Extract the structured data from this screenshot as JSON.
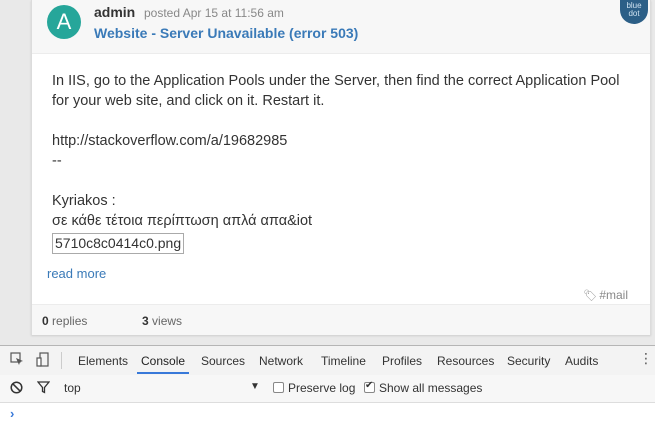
{
  "post": {
    "avatar_letter": "A",
    "author": "admin",
    "posted": "posted Apr 15 at 11:56 am",
    "subject": "Website - Server Unavailable (error 503)",
    "logo_text_1": "blue",
    "logo_text_2": "dot",
    "body_line_1": "In IIS, go to the Application Pools under the Server, then find the correct Application Pool",
    "body_line_2": "for your web site, and click on it. Restart it.",
    "link": "http://stackoverflow.com/a/19682985",
    "signature_sep": "--",
    "sender": "Kyriakos :",
    "greek_line": "σε κάθε τέτοια περίπτωση απλά απα&iot",
    "attachment": "5710c8c0414c0.png",
    "read_more": "read more",
    "tag": "#mail",
    "replies_count": "0",
    "replies_label": "replies",
    "views_count": "3",
    "views_label": "views"
  },
  "devtools": {
    "tabs": [
      "Elements",
      "Console",
      "Sources",
      "Network",
      "Timeline",
      "Profiles",
      "Resources",
      "Security",
      "Audits"
    ],
    "active_tab": "Console",
    "context": "top",
    "preserve_log": "Preserve log",
    "show_all": "Show all messages",
    "prompt": "›"
  },
  "colors": {
    "avatar": "#26a69a",
    "link": "#3a7ab8",
    "tab_active": "#3879d9"
  }
}
